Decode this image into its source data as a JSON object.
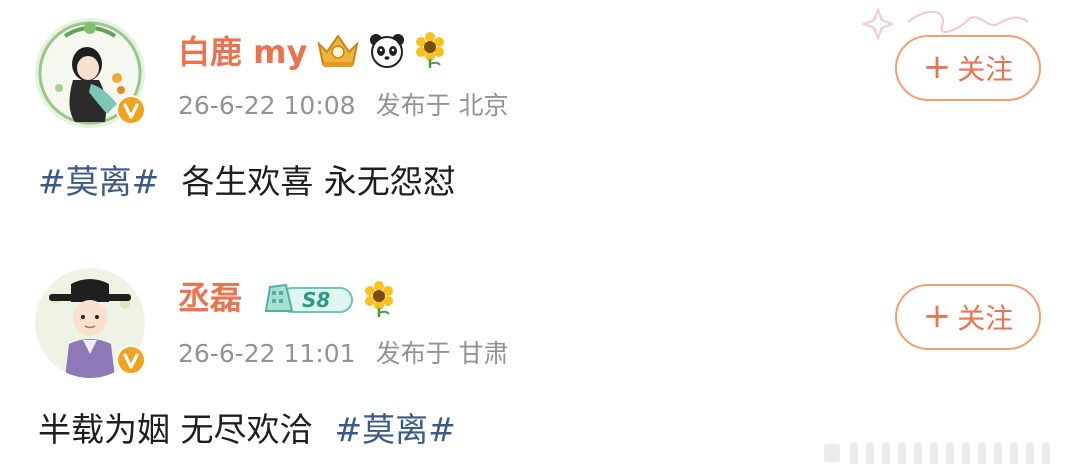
{
  "posts": [
    {
      "username": "白鹿 my",
      "date": "26-6-22 10:08",
      "location": "发布于 北京",
      "follow_label": "关注",
      "topic": "#莫离#",
      "text": "各生欢喜 永无怨怼",
      "badges": [
        "crown-badge-icon",
        "panda-icon",
        "sunflower-icon"
      ]
    },
    {
      "username": "丞磊",
      "date": "26-6-22 11:01",
      "location": "发布于 甘肃",
      "follow_label": "关注",
      "text": "半载为姻 无尽欢洽",
      "topic": "#莫离#",
      "level_badge": "S8",
      "badges": [
        "level-badge-icon",
        "sunflower-icon"
      ]
    }
  ],
  "colors": {
    "username": "#eb7350",
    "meta": "#939393",
    "topic": "#3c5a86",
    "follow_border": "#f4a06e",
    "verified": "#f2a21d"
  }
}
